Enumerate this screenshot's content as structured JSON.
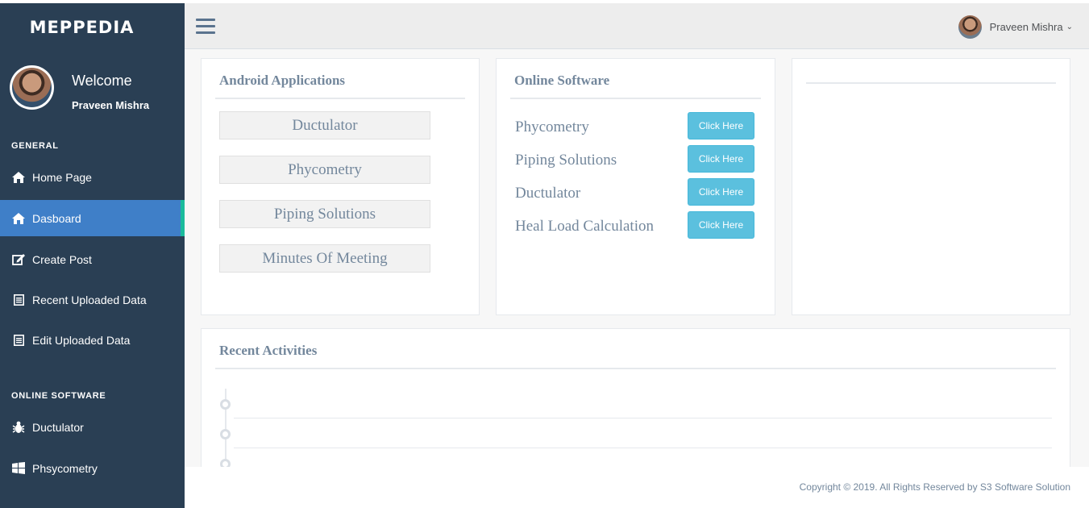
{
  "sidebar": {
    "brand": "MEPPEDIA",
    "welcome": "Welcome",
    "user_name": "Praveen Mishra",
    "general_title": "GENERAL",
    "online_title": "ONLINE SOFTWARE",
    "general_items": [
      {
        "label": "Home Page",
        "icon": "home-icon"
      },
      {
        "label": "Dasboard",
        "icon": "home-icon",
        "active": true
      },
      {
        "label": "Create Post",
        "icon": "edit-icon"
      },
      {
        "label": "Recent Uploaded Data",
        "icon": "list-icon"
      },
      {
        "label": "Edit Uploaded Data",
        "icon": "list-icon"
      }
    ],
    "online_items": [
      {
        "label": "Ductulator",
        "icon": "bug-icon"
      },
      {
        "label": "Phsycometry",
        "icon": "windows-icon"
      }
    ]
  },
  "topbar": {
    "user_name": "Praveen Mishra"
  },
  "android": {
    "title": "Android Applications",
    "apps": [
      "Ductulator",
      "Phycometry",
      "Piping Solutions",
      "Minutes Of Meeting"
    ]
  },
  "online": {
    "title": "Online Software",
    "items": [
      {
        "label": "Phycometry",
        "button": "Click Here"
      },
      {
        "label": "Piping Solutions",
        "button": "Click Here"
      },
      {
        "label": "Ductulator",
        "button": "Click Here"
      },
      {
        "label": "Heal Load Calculation",
        "button": "Click Here"
      }
    ]
  },
  "recent": {
    "title": "Recent Activities"
  },
  "footer": {
    "copyright": "Copyright © 2019. All Rights Reserved by S3 Software Solution"
  },
  "colors": {
    "sidebar": "#2a3f54",
    "active": "#3f7fc8",
    "active_border": "#1abb9c",
    "button": "#5bc0de",
    "text": "#73879c"
  }
}
